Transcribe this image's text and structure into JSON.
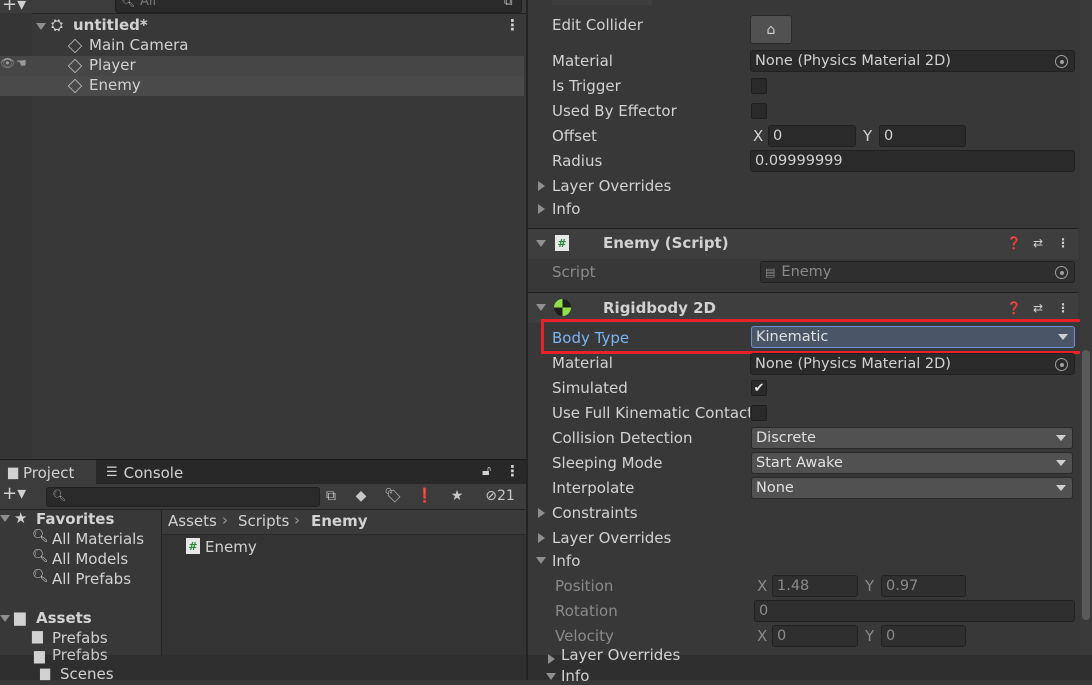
{
  "hierarchy": {
    "search_placeholder": "All",
    "scene": "untitled*",
    "items": [
      "Main Camera",
      "Player",
      "Enemy"
    ]
  },
  "project": {
    "tabs": [
      "Project",
      "Console"
    ],
    "hidden_count": "21",
    "favorites_label": "Favorites",
    "favorites": [
      "All Materials",
      "All Models",
      "All Prefabs"
    ],
    "assets_label": "Assets",
    "asset_folders": [
      "Prefabs"
    ],
    "overflow_items": [
      "Prefabs",
      "Scenes"
    ],
    "breadcrumb": [
      "Assets",
      "Scripts",
      "Enemy"
    ],
    "files": [
      "Enemy"
    ]
  },
  "inspector": {
    "collider": {
      "edit_collider": "Edit Collider",
      "material_label": "Material",
      "material_value": "None (Physics Material 2D)",
      "is_trigger": "Is Trigger",
      "used_by_effector": "Used By Effector",
      "offset": "Offset",
      "offset_x_label": "X",
      "offset_x": "0",
      "offset_y_label": "Y",
      "offset_y": "0",
      "radius": "Radius",
      "radius_value": "0.09999999",
      "layer_overrides": "Layer Overrides",
      "info": "Info"
    },
    "script_comp": {
      "title": "Enemy (Script)",
      "script_label": "Script",
      "script_value": "Enemy"
    },
    "rigidbody": {
      "title": "Rigidbody 2D",
      "body_type_label": "Body Type",
      "body_type": "Kinematic",
      "material_label": "Material",
      "material_value": "None (Physics Material 2D)",
      "simulated": "Simulated",
      "use_full_kinematic": "Use Full Kinematic Contacts",
      "collision_detection": "Collision Detection",
      "collision_value": "Discrete",
      "sleeping_mode": "Sleeping Mode",
      "sleeping_value": "Start Awake",
      "interpolate": "Interpolate",
      "interpolate_value": "None",
      "constraints": "Constraints",
      "layer_overrides": "Layer Overrides",
      "info": "Info",
      "position": "Position",
      "pos_x_label": "X",
      "pos_x": "1.48",
      "pos_y_label": "Y",
      "pos_y": "0.97",
      "rotation": "Rotation",
      "rotation_value": "0",
      "velocity": "Velocity",
      "vel_x_label": "X",
      "vel_x": "0",
      "vel_y_label": "Y",
      "vel_y": "0"
    },
    "overflow": [
      "Layer Overrides",
      "Info"
    ]
  },
  "colors": {
    "highlight": "#e8202a",
    "link_blue": "#7cb5f5"
  }
}
